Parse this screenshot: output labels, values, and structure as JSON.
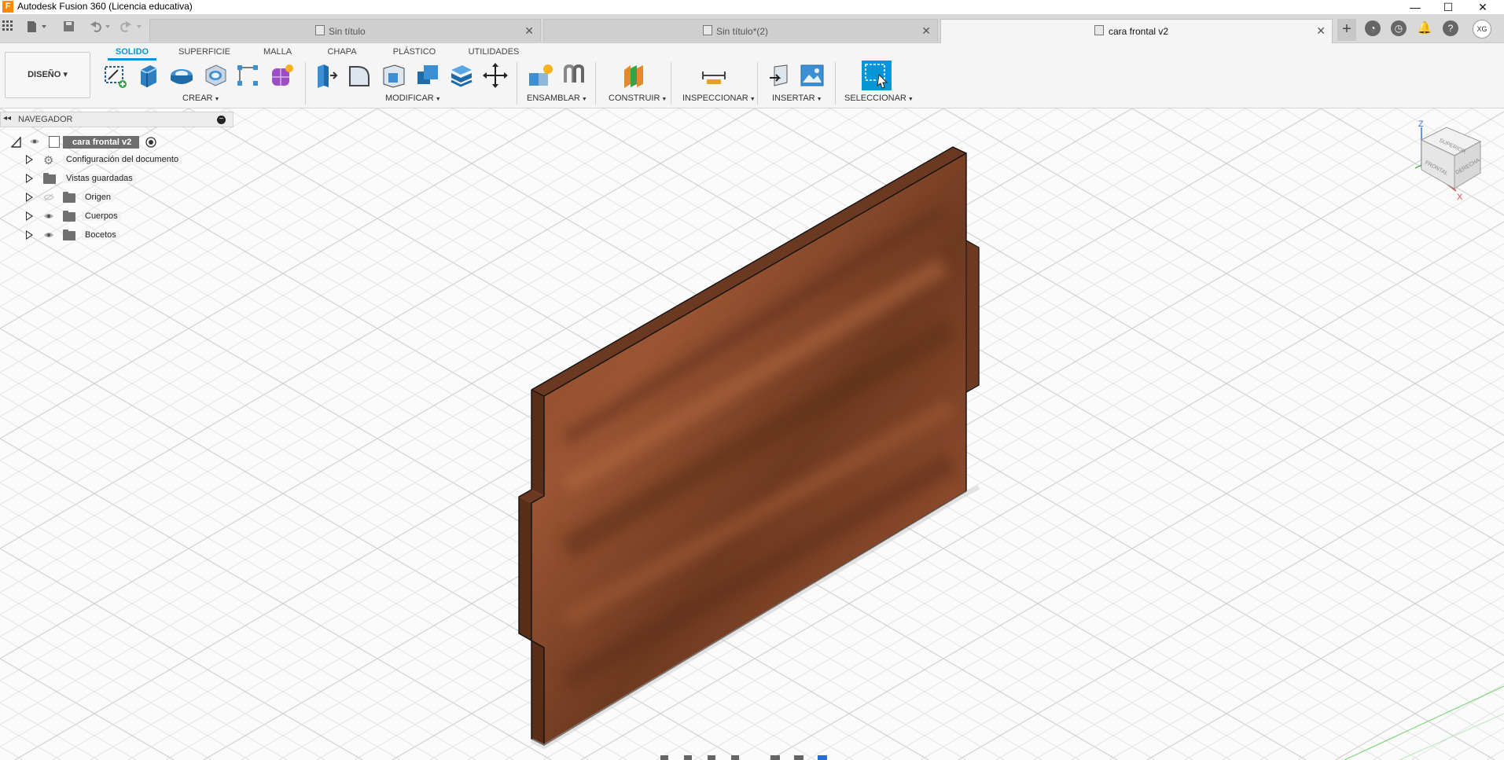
{
  "window": {
    "app_title": "Autodesk Fusion 360 (Licencia educativa)",
    "logo_letter": "F",
    "minimize": "—",
    "maximize": "☐",
    "close": "✕"
  },
  "document_tabs": [
    {
      "label": "Sin título",
      "close": "✕"
    },
    {
      "label": "Sin título*(2)",
      "close": "✕"
    },
    {
      "label": "cara frontal v2",
      "close": "✕"
    }
  ],
  "tabbar_icons": {
    "add": "+",
    "user_initials": "XG"
  },
  "toolbar": {
    "workspace": "DISEÑO ▾",
    "tabs": [
      "SOLIDO",
      "SUPERFICIE",
      "MALLA",
      "CHAPA",
      "PLÁSTICO",
      "UTILIDADES"
    ],
    "active_tab": "SOLIDO",
    "groups": [
      {
        "label": "CREAR"
      },
      {
        "label": "MODIFICAR"
      },
      {
        "label": "ENSAMBLAR"
      },
      {
        "label": "CONSTRUIR"
      },
      {
        "label": "INSPECCIONAR"
      },
      {
        "label": "INSERTAR"
      },
      {
        "label": "SELECCIONAR"
      }
    ],
    "accent": "#0696d7"
  },
  "browser": {
    "title": "NAVEGADOR",
    "root": "cara frontal v2",
    "items": [
      {
        "label": "Configuración del documento",
        "icon": "gear-icon"
      },
      {
        "label": "Vistas guardadas",
        "icon": "folder-icon"
      },
      {
        "label": "Origen",
        "icon": "folder-icon",
        "visibility": "hidden"
      },
      {
        "label": "Cuerpos",
        "icon": "folder-icon",
        "visibility": "visible"
      },
      {
        "label": "Bocetos",
        "icon": "folder-icon",
        "visibility": "visible"
      }
    ]
  },
  "viewcube": {
    "axis_z": "Z",
    "axis_x": "X",
    "face_top": "SUPERIOR",
    "face_front": "FRONTAL",
    "face_right": "DERECHA"
  },
  "model": {
    "material": "wood",
    "color": "#8a4a2c"
  }
}
